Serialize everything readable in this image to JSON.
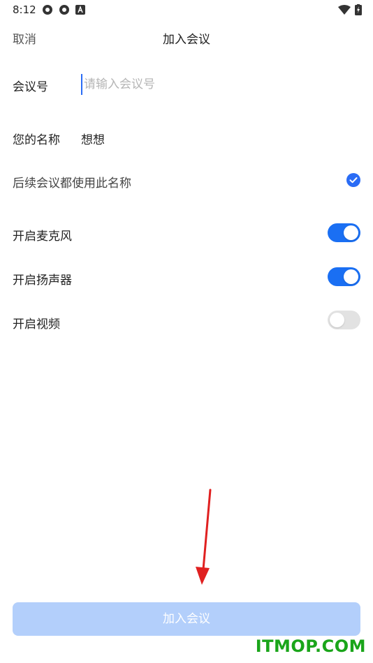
{
  "status_bar": {
    "time": "8:12"
  },
  "nav": {
    "cancel_label": "取消",
    "title": "加入会议"
  },
  "meeting_id": {
    "label": "会议号",
    "placeholder": "请输入会议号",
    "value": ""
  },
  "name": {
    "label": "您的名称",
    "value": "想想"
  },
  "remember_name": {
    "label": "后续会议都使用此名称",
    "checked": true
  },
  "toggles": {
    "mic": {
      "label": "开启麦克风",
      "on": true
    },
    "speaker": {
      "label": "开启扬声器",
      "on": true
    },
    "video": {
      "label": "开启视频",
      "on": false
    }
  },
  "join_button": {
    "label": "加入会议",
    "enabled": false
  },
  "watermark": "ITMOP.COM",
  "colors": {
    "accent": "#1a6ff3",
    "button_disabled": "#b3cffb",
    "watermark": "#1aa51a",
    "annotation_arrow": "#e02020"
  }
}
